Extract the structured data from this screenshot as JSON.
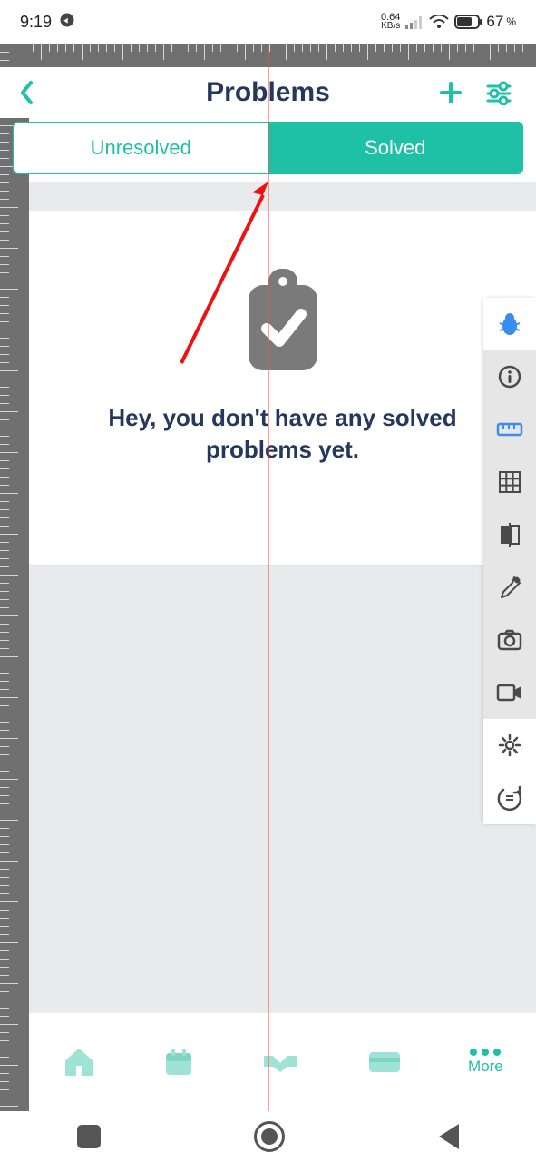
{
  "status": {
    "time": "9:19",
    "kbps_value": "0.64",
    "kbps_unit": "KB/s",
    "battery_pct": "67",
    "battery_pct_sym": "%"
  },
  "header": {
    "title": "Problems"
  },
  "tabs": {
    "unresolved": "Unresolved",
    "solved": "Solved"
  },
  "empty_state": {
    "line1": "Hey, you don't have any solved",
    "line2": "problems yet."
  },
  "bottom_nav": {
    "more_label": "More"
  },
  "dev_toolbar": {
    "items": [
      "bug",
      "info",
      "ruler",
      "grid",
      "compare",
      "eyedropper",
      "camera",
      "video",
      "settings",
      "rotate"
    ]
  }
}
